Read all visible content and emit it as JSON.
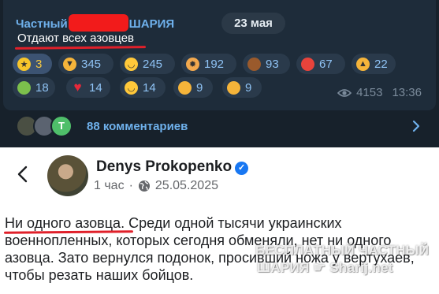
{
  "telegram": {
    "channel_prefix": "Частный",
    "channel_suffix": "ШАРИЯ",
    "date": "23 мая",
    "post_text": "Отдают всех азовцев",
    "reactions": [
      {
        "icon": "star-icon",
        "count": "3",
        "active": true
      },
      {
        "icon": "thumbs-down-icon",
        "count": "345"
      },
      {
        "icon": "rofl-icon",
        "count": "245"
      },
      {
        "icon": "exploding-head-icon",
        "count": "192"
      },
      {
        "icon": "poop-icon",
        "count": "93"
      },
      {
        "icon": "angry-face-icon",
        "count": "67"
      },
      {
        "icon": "thumbs-up-icon",
        "count": "22"
      },
      {
        "icon": "vomiting-face-icon",
        "count": "18"
      },
      {
        "icon": "heart-icon",
        "count": "14"
      },
      {
        "icon": "grin-icon",
        "count": "14"
      },
      {
        "icon": "thinking-face-icon",
        "count": "9"
      },
      {
        "icon": "woozy-face-icon",
        "count": "9"
      }
    ],
    "views": "4153",
    "time": "13:36",
    "comments_avatar_letter": "Т",
    "comments_label": "88 комментариев"
  },
  "facebook": {
    "author": "Denys Prokopenko",
    "time_ago": "1 час",
    "date": "25.05.2025",
    "text_highlight": "Ни одного азовца",
    "text_rest": ". Среди одной тысячи украинских военнопленных, которых сегодня обменяли, нет ни одного азовца. Зато вернулся подонок, просивший ножа у вертухаев, чтобы резать наших бойцов."
  },
  "watermark": {
    "line1": "БЕСПЛАТНЫЙ ЧАСТНЫЙ",
    "line2": "ШАРИЯ",
    "line2_site": "Sharij.net"
  },
  "colors": {
    "tg_bg": "#17212b",
    "tg_accent": "#6fb1ec",
    "underline_red": "#e0202a",
    "fb_blue": "#1877f2"
  }
}
